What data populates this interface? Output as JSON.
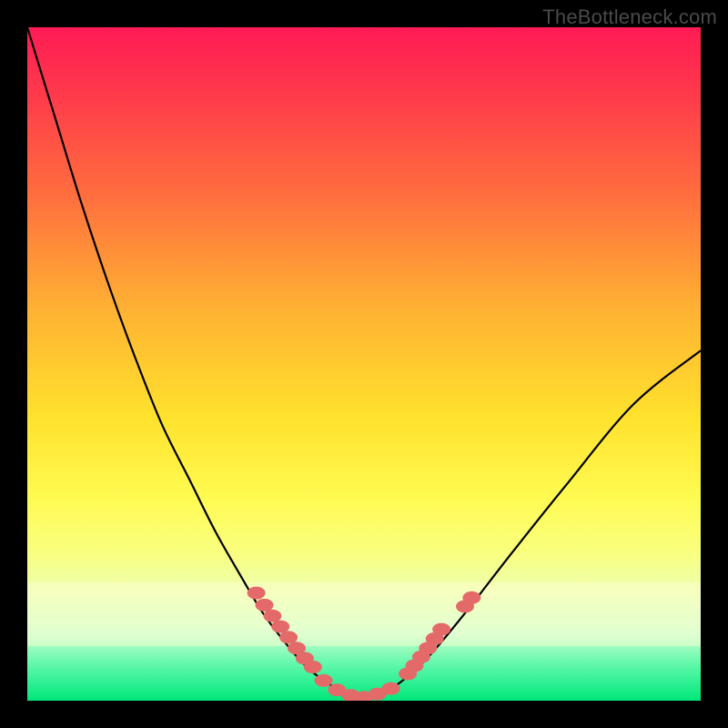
{
  "watermark": "TheBottleneck.com",
  "colors": {
    "dot": "#e46a6a",
    "curve": "#000000",
    "frame": "#000000"
  },
  "chart_data": {
    "type": "line",
    "title": "",
    "xlabel": "",
    "ylabel": "",
    "xlim": [
      0,
      100
    ],
    "ylim": [
      0,
      100
    ],
    "grid": false,
    "legend": false,
    "series": [
      {
        "name": "bottleneck-curve",
        "x": [
          0,
          4,
          8,
          12,
          16,
          20,
          24,
          28,
          32,
          35,
          38,
          41,
          44,
          47,
          50,
          53,
          56,
          60,
          65,
          72,
          80,
          90,
          100
        ],
        "y": [
          100,
          87,
          74,
          62,
          51,
          41,
          33,
          25,
          18,
          13,
          9,
          5.5,
          3,
          1.3,
          0.5,
          1.3,
          3.2,
          7,
          13,
          22,
          32,
          44,
          52
        ]
      }
    ],
    "points": [
      {
        "name": "left-cluster-1",
        "x": 34.0,
        "y": 16.0
      },
      {
        "name": "left-cluster-2",
        "x": 35.2,
        "y": 14.2
      },
      {
        "name": "left-cluster-3",
        "x": 36.4,
        "y": 12.6
      },
      {
        "name": "left-cluster-4",
        "x": 37.6,
        "y": 11.0
      },
      {
        "name": "left-cluster-5",
        "x": 38.8,
        "y": 9.4
      },
      {
        "name": "left-cluster-6",
        "x": 40.0,
        "y": 7.8
      },
      {
        "name": "left-cluster-7",
        "x": 41.2,
        "y": 6.3
      },
      {
        "name": "left-cluster-8",
        "x": 42.4,
        "y": 5.0
      },
      {
        "name": "bottom-1",
        "x": 44.0,
        "y": 3.0
      },
      {
        "name": "bottom-2",
        "x": 46.0,
        "y": 1.6
      },
      {
        "name": "bottom-3",
        "x": 48.0,
        "y": 0.8
      },
      {
        "name": "bottom-4",
        "x": 50.0,
        "y": 0.5
      },
      {
        "name": "bottom-5",
        "x": 52.0,
        "y": 1.0
      },
      {
        "name": "bottom-6",
        "x": 54.0,
        "y": 1.8
      },
      {
        "name": "right-cluster-1",
        "x": 56.5,
        "y": 4.0
      },
      {
        "name": "right-cluster-2",
        "x": 57.5,
        "y": 5.2
      },
      {
        "name": "right-cluster-3",
        "x": 58.5,
        "y": 6.5
      },
      {
        "name": "right-cluster-4",
        "x": 59.5,
        "y": 7.8
      },
      {
        "name": "right-cluster-5",
        "x": 60.5,
        "y": 9.2
      },
      {
        "name": "right-cluster-6",
        "x": 61.5,
        "y": 10.6
      },
      {
        "name": "right-upper-1",
        "x": 65.0,
        "y": 14.0
      },
      {
        "name": "right-upper-2",
        "x": 66.0,
        "y": 15.3
      }
    ]
  }
}
